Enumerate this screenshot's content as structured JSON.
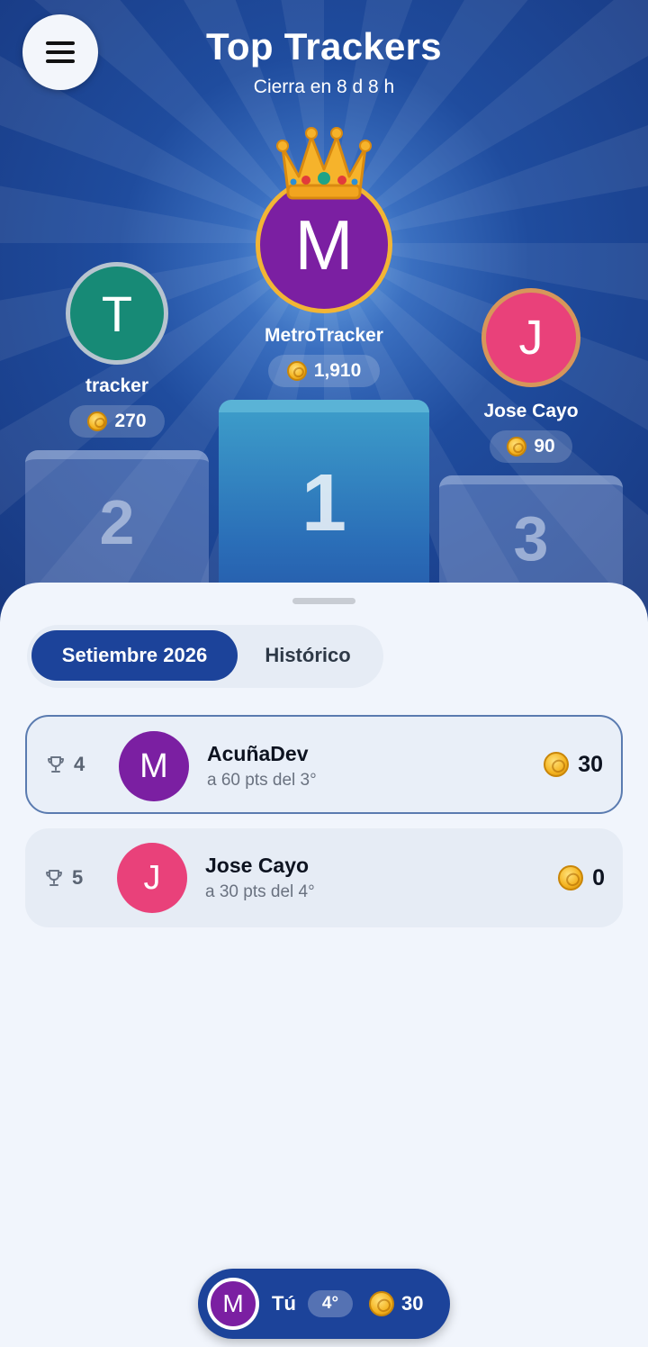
{
  "header": {
    "title": "Top Trackers",
    "subtitle": "Cierra en 8 d 8 h"
  },
  "podium": {
    "first": {
      "initial": "M",
      "name": "MetroTracker",
      "score": "1,910",
      "place": "1",
      "color": "#7b1fa2"
    },
    "second": {
      "initial": "T",
      "name": "tracker",
      "score": "270",
      "place": "2",
      "color": "#178a76"
    },
    "third": {
      "initial": "J",
      "name": "Jose Cayo",
      "score": "90",
      "place": "3",
      "color": "#e9417a"
    }
  },
  "tabs": [
    {
      "label": "Setiembre 2026",
      "active": true
    },
    {
      "label": "Histórico",
      "active": false
    }
  ],
  "rows": [
    {
      "rank": "4",
      "initial": "M",
      "name": "AcuñaDev",
      "sub": "a 60 pts del 3°",
      "score": "30",
      "highlighted": true,
      "color": "#7b1fa2"
    },
    {
      "rank": "5",
      "initial": "J",
      "name": "Jose Cayo",
      "sub": "a 30 pts del 4°",
      "score": "0",
      "highlighted": false,
      "color": "#e9417a"
    }
  ],
  "me": {
    "initial": "M",
    "label": "Tú",
    "rank": "4°",
    "score": "30"
  },
  "colors": {
    "accent": "#1c439a",
    "gold": "#f2b535"
  },
  "icons": [
    "menu-icon",
    "crown-icon",
    "coin-icon",
    "trophy-icon"
  ]
}
